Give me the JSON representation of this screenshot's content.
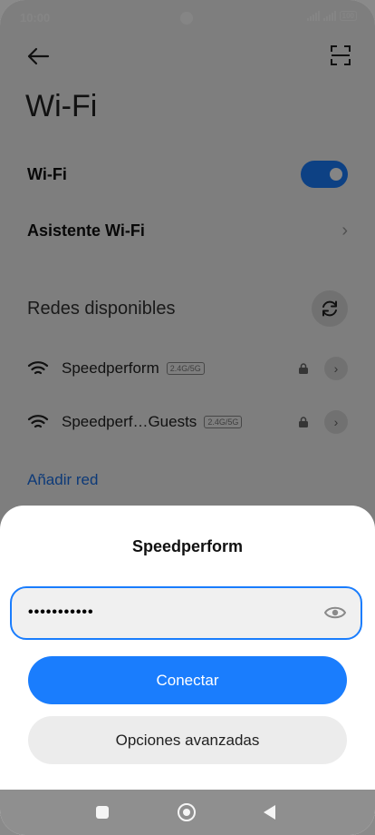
{
  "status": {
    "time": "10:00",
    "battery": "100"
  },
  "page": {
    "title": "Wi-Fi"
  },
  "wifi_toggle": {
    "label": "Wi-Fi",
    "on": true
  },
  "assistant": {
    "label": "Asistente Wi-Fi"
  },
  "available": {
    "title": "Redes disponibles"
  },
  "networks": [
    {
      "ssid": "Speedperform",
      "band": "2.4G/5G",
      "secured": true
    },
    {
      "ssid": "Speedperf…Guests",
      "band": "2.4G/5G",
      "secured": true
    }
  ],
  "add_network": "Añadir red",
  "dialog": {
    "title": "Speedperform",
    "password_masked": "•••••••••••",
    "connect_label": "Conectar",
    "advanced_label": "Opciones avanzadas"
  },
  "colors": {
    "accent": "#1a7dfd",
    "link": "#1a6fe6"
  }
}
